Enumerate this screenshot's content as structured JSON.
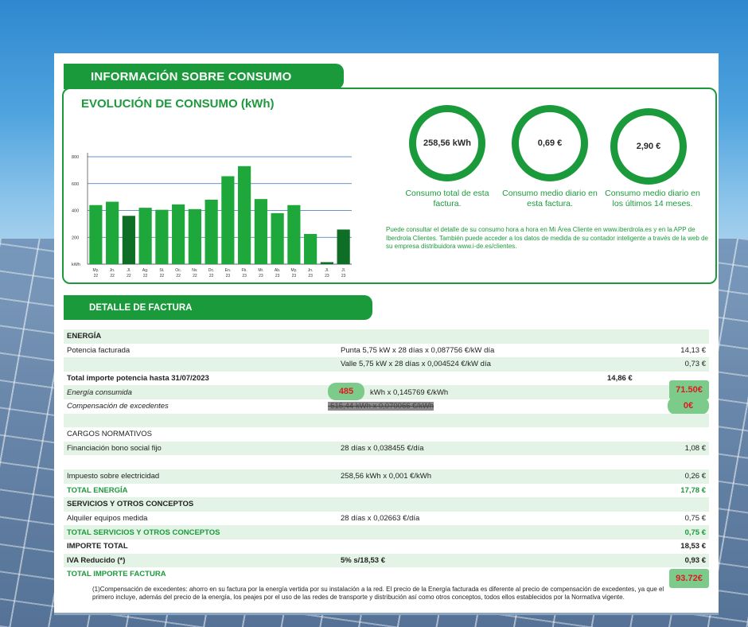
{
  "header": {
    "title": "INFORMACIÓN SOBRE CONSUMO"
  },
  "evolution": {
    "title": "EVOLUCIÓN DE CONSUMO (kWh)"
  },
  "chart_data": {
    "type": "bar",
    "title": "EVOLUCIÓN DE CONSUMO (kWh)",
    "ylabel": "kWh",
    "ylim": [
      0,
      800
    ],
    "yticks": [
      "0",
      "200",
      "400",
      "600",
      "800"
    ],
    "categories": [
      "My. 22",
      "Jn. 22",
      "Jl. 22",
      "Ag. 22",
      "St. 22",
      "Oc. 22",
      "Nv. 22",
      "Dc. 22",
      "En. 23",
      "Fb. 23",
      "Mr. 23",
      "Ab. 23",
      "My. 23",
      "Jn. 23",
      "Jl. 23",
      "Jl. 23"
    ],
    "cat_top": [
      "My.",
      "Jn.",
      "Jl.",
      "Ag.",
      "St.",
      "Oc.",
      "Nv.",
      "Dc.",
      "En.",
      "Fb.",
      "Mr.",
      "Ab.",
      "My.",
      "Jn.",
      "Jl.",
      "Jl."
    ],
    "cat_bottom": [
      "22",
      "22",
      "22",
      "22",
      "22",
      "22",
      "22",
      "22",
      "23",
      "23",
      "23",
      "23",
      "23",
      "23",
      "23",
      "23"
    ],
    "values": [
      440,
      465,
      360,
      420,
      405,
      445,
      410,
      480,
      655,
      730,
      485,
      380,
      440,
      225,
      15,
      258
    ],
    "highlight_indices": [
      2,
      14,
      15
    ],
    "colors": {
      "normal": "#1ea83c",
      "highlight": "#0f6e25"
    },
    "grid": true
  },
  "summary": {
    "total": {
      "value": "258,56 kWh",
      "label": "Consumo total de esta factura."
    },
    "daily": {
      "value": "0,69 €",
      "label": "Consumo medio diario en esta factura."
    },
    "daily14": {
      "value": "2,90 €",
      "label": "Consumo medio diario en los últimos 14 meses."
    },
    "note": "Puede consultar el detalle de su consumo hora a hora en Mi Área Cliente en www.iberdrola.es y en la APP de Iberdrola Clientes. También puede acceder a los datos de medida de su contador inteligente a través de la web de su empresa distribuidora www.i-de.es/clientes."
  },
  "detalle": {
    "title": "DETALLE DE FACTURA"
  },
  "rows": {
    "energia": "ENERGÍA",
    "potencia": {
      "label": "Potencia facturada",
      "punta": "Punta 5,75 kW x 28 días x 0,087756 €/kW día",
      "punta_amt": "14,13 €",
      "valle": "Valle 5,75 kW x 28 días x 0,004524 €/kW día",
      "valle_amt": "0,73 €"
    },
    "total_potencia": {
      "label": "Total importe potencia hasta 31/07/2023",
      "amt": "14,86 €"
    },
    "energia_consumida": {
      "label": "Energía consumida",
      "kwh": "485",
      "detail": "kWh x 0,145769 €/kWh",
      "amt": "71.50€"
    },
    "compensacion": {
      "label": "Compensación de excedentes",
      "detail": "-515,44 kWh x 0,070066 €/kWh",
      "amt": "0€"
    },
    "cargos": "CARGOS NORMATIVOS",
    "bono": {
      "label": "Financiación bono social fijo",
      "detail": "28 días x 0,038455 €/día",
      "amt": "1,08 €"
    },
    "impuesto": {
      "label": "Impuesto sobre electricidad",
      "detail": "258,56 kWh x 0,001 €/kWh",
      "amt": "0,26 €"
    },
    "total_energia": {
      "label": "TOTAL ENERGÍA",
      "amt": "17,78 €"
    },
    "servicios": "SERVICIOS Y OTROS CONCEPTOS",
    "alquiler": {
      "label": "Alquiler equipos medida",
      "detail": "28 días x 0,02663 €/día",
      "amt": "0,75 €"
    },
    "total_servicios": {
      "label": "TOTAL SERVICIOS Y OTROS CONCEPTOS",
      "amt": "0,75 €"
    },
    "importe_total": {
      "label": "IMPORTE TOTAL",
      "amt": "18,53 €"
    },
    "iva": {
      "label": "IVA Reducido (*)",
      "detail": "5% s/18,53 €",
      "amt": "0,93 €"
    },
    "total_factura": {
      "label": "TOTAL IMPORTE FACTURA",
      "amt": "93.72€"
    }
  },
  "footnote": "(1)Compensación de excedentes: ahorro en su factura por la energía vertida por su instalación a la red. El precio de la Energía facturada es diferente al precio de compensación de excedentes, ya que el primero incluye, además del precio de la energía, los peajes por el uso de las redes de transporte y distribución así como otros conceptos, todos ellos establecidos por la Normativa vigente."
}
